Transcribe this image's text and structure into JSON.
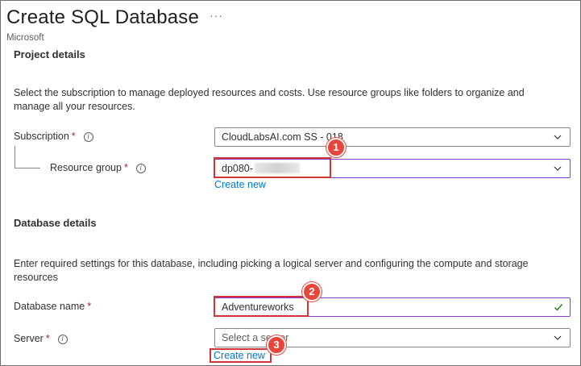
{
  "header": {
    "title": "Create SQL Database",
    "more_label": "···",
    "subtitle": "Microsoft"
  },
  "project_details": {
    "heading": "Project details",
    "description": "Select the subscription to manage deployed resources and costs. Use resource groups like folders to organize and manage all your resources.",
    "subscription": {
      "label": "Subscription",
      "required_mark": "*",
      "value": "CloudLabsAI.com SS - 018"
    },
    "resource_group": {
      "label": "Resource group",
      "required_mark": "*",
      "value": "dp080-",
      "create_new_label": "Create new"
    }
  },
  "database_details": {
    "heading": "Database details",
    "description": "Enter required settings for this database, including picking a logical server and configuring the compute and storage resources",
    "database_name": {
      "label": "Database name",
      "required_mark": "*",
      "value": "Adventureworks"
    },
    "server": {
      "label": "Server",
      "required_mark": "*",
      "placeholder": "Select a server",
      "create_new_label": "Create new"
    }
  },
  "callouts": [
    "1",
    "2",
    "3"
  ],
  "colors": {
    "accent_link": "#0078d4",
    "required_star": "#a4262c",
    "callout_red": "#e8453c",
    "focus_purple": "#8a3ac6",
    "valid_green": "#107c10"
  }
}
